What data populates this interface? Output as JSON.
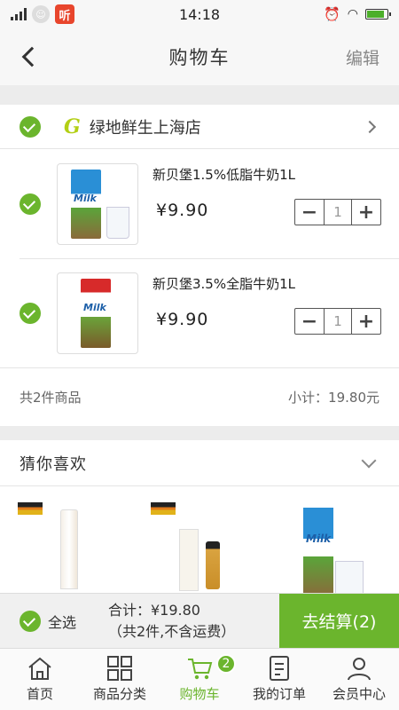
{
  "status": {
    "time": "14:18",
    "app_label": "听"
  },
  "nav": {
    "title": "购物车",
    "edit_label": "编辑"
  },
  "store": {
    "logo": "G",
    "name": "绿地鲜生上海店",
    "items": [
      {
        "name": "新贝堡1.5%低脂牛奶1L",
        "price": "¥9.90",
        "qty": "1",
        "pack_text": "Milk"
      },
      {
        "name": "新贝堡3.5%全脂牛奶1L",
        "price": "¥9.90",
        "qty": "1",
        "pack_text": "Milk"
      }
    ],
    "count_text": "共2件商品",
    "subtotal_text": "小计：19.80元"
  },
  "guess": {
    "title": "猜你喜欢",
    "third_pack_text": "Milk"
  },
  "checkout": {
    "select_all": "全选",
    "total": "合计：¥19.80",
    "note": "（共2件,不含运费）",
    "button": "去结算(2)"
  },
  "tabs": [
    {
      "label": "首页",
      "icon": "home-icon"
    },
    {
      "label": "商品分类",
      "icon": "grid-icon"
    },
    {
      "label": "购物车",
      "icon": "cart-icon",
      "badge": "2",
      "active": true
    },
    {
      "label": "我的订单",
      "icon": "order-icon"
    },
    {
      "label": "会员中心",
      "icon": "user-icon"
    }
  ],
  "colors": {
    "accent": "#6bb52d",
    "logo": "#b3cf15",
    "battery": "#4caf2a"
  }
}
